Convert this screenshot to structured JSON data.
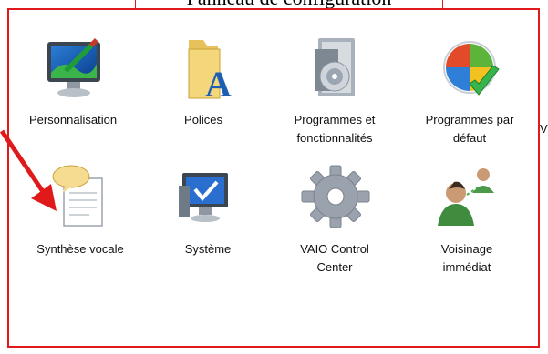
{
  "window": {
    "title": "Panneau de configuration"
  },
  "items": [
    {
      "label": "Personnalisation",
      "icon": "personalization-icon"
    },
    {
      "label": "Polices",
      "icon": "fonts-folder-icon"
    },
    {
      "label": "Programmes et\nfonctionnalités",
      "icon": "programs-features-icon"
    },
    {
      "label": "Programmes par\ndéfaut",
      "icon": "default-programs-icon"
    },
    {
      "label": "Synthèse vocale",
      "icon": "speech-synthesis-icon"
    },
    {
      "label": "Système",
      "icon": "system-icon"
    },
    {
      "label": "VAIO Control\nCenter",
      "icon": "gear-icon"
    },
    {
      "label": "Voisinage\nimmédiat",
      "icon": "people-near-me-icon"
    }
  ],
  "cut_off_label": "V",
  "annotation": {
    "arrow_color": "#e01a1a",
    "frame_color": "#e01a1a"
  }
}
